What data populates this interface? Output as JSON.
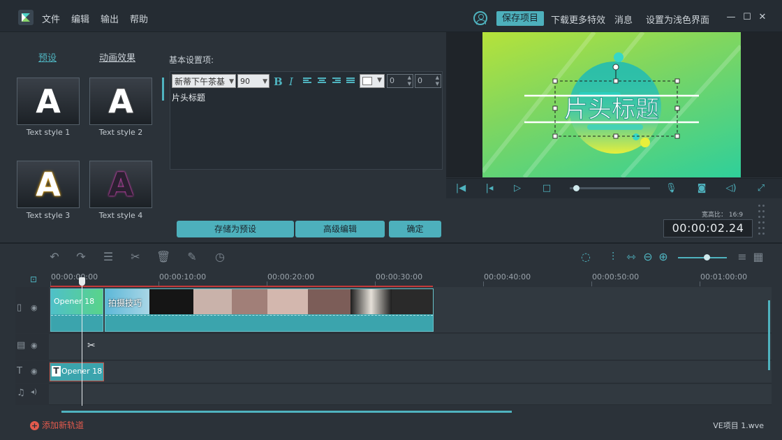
{
  "app": {
    "menu": [
      "文件",
      "编辑",
      "输出",
      "帮助"
    ],
    "save_label": "保存项目",
    "links": [
      "下载更多特效",
      "消息",
      "设置为浅色界面"
    ],
    "window_controls": [
      "—",
      "☐",
      "✕"
    ]
  },
  "left_panel": {
    "tabs": [
      "预设",
      "动画效果"
    ],
    "styles": [
      {
        "label": "Text style 1",
        "glyph": "A"
      },
      {
        "label": "Text style 2",
        "glyph": "A"
      },
      {
        "label": "Text style 3",
        "glyph": "A"
      },
      {
        "label": "Text style 4",
        "glyph": "A"
      }
    ]
  },
  "editor": {
    "section_label": "基本设置项:",
    "font": "新蒂下午茶基",
    "size": "90",
    "bold": "B",
    "italic": "I",
    "spin1": "0",
    "spin2": "0",
    "text": "片头标题",
    "text_color": "#ffffff"
  },
  "actions": {
    "save_preset": "存储为预设",
    "advanced": "高级编辑",
    "ok": "确定"
  },
  "preview": {
    "title_text": "片头标题",
    "aspect": "宽高比：  16:9",
    "timecode": "00:00:02.24",
    "progress": 0.07
  },
  "timeline": {
    "ruler": [
      "00:00:00:00",
      "00:00:10:00",
      "00:00:20:00",
      "00:00:30:00",
      "00:00:40:00",
      "00:00:50:00",
      "00:01:00:00"
    ],
    "clips": {
      "video1": "Opener 18",
      "video2": "拍摄技巧",
      "text": "Opener 18"
    },
    "zoom": 0.55
  },
  "footer": {
    "add_track": "添加新轨道",
    "project": "VE项目 1.wve"
  },
  "colors": {
    "accent": "#4fb3bf",
    "danger": "#e25a4d",
    "background": "#2b3239"
  }
}
